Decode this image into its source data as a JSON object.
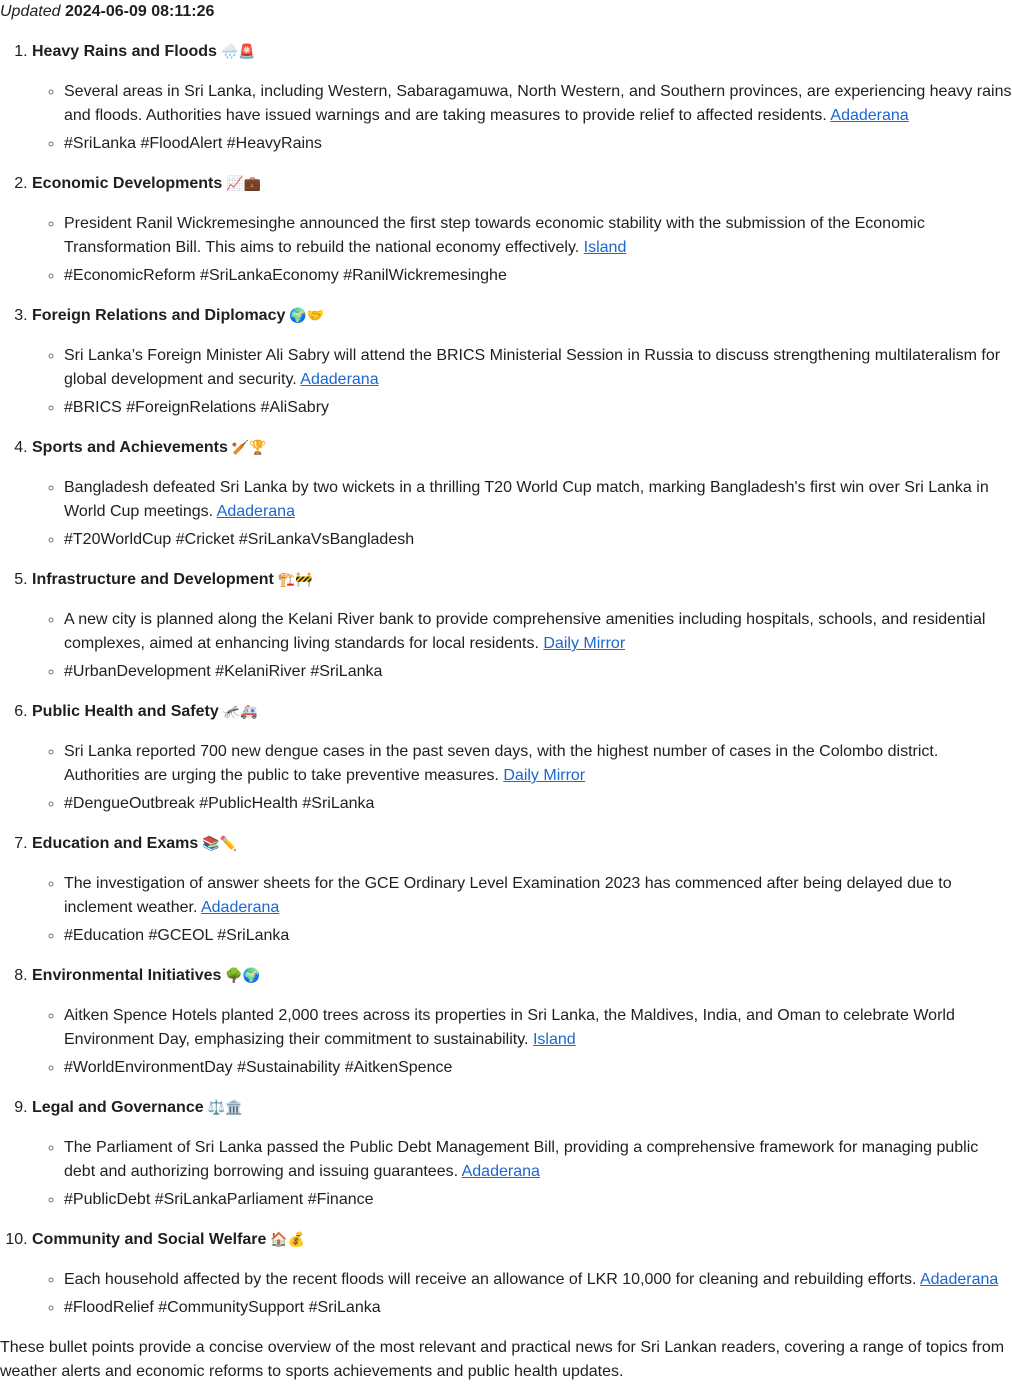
{
  "header": {
    "updated_label": "Updated",
    "updated_value": "2024-06-09 08:11:26"
  },
  "colors": {
    "text": "#1f1f1f",
    "link": "#1a66d2",
    "marker": "#777777"
  },
  "topics": [
    {
      "title": "Heavy Rains and Floods",
      "emoji": "🌧️🚨",
      "summary": "Several areas in Sri Lanka, including Western, Sabaragamuwa, North Western, and Southern provinces, are experiencing heavy rains and floods. Authorities have issued warnings and are taking measures to provide relief to affected residents.",
      "source": "Adaderana",
      "hashtags": "#SriLanka #FloodAlert #HeavyRains"
    },
    {
      "title": "Economic Developments",
      "emoji": "📈💼",
      "summary": "President Ranil Wickremesinghe announced the first step towards economic stability with the submission of the Economic Transformation Bill. This aims to rebuild the national economy effectively.",
      "source": "Island",
      "hashtags": "#EconomicReform #SriLankaEconomy #RanilWickremesinghe"
    },
    {
      "title": "Foreign Relations and Diplomacy",
      "emoji": "🌍🤝",
      "summary": "Sri Lanka’s Foreign Minister Ali Sabry will attend the BRICS Ministerial Session in Russia to discuss strengthening multilateralism for global development and security.",
      "source": "Adaderana",
      "hashtags": "#BRICS #ForeignRelations #AliSabry"
    },
    {
      "title": "Sports and Achievements",
      "emoji": "🏏🏆",
      "summary": "Bangladesh defeated Sri Lanka by two wickets in a thrilling T20 World Cup match, marking Bangladesh's first win over Sri Lanka in World Cup meetings.",
      "source": "Adaderana",
      "hashtags": "#T20WorldCup #Cricket #SriLankaVsBangladesh"
    },
    {
      "title": "Infrastructure and Development",
      "emoji": "🏗️🚧",
      "summary": "A new city is planned along the Kelani River bank to provide comprehensive amenities including hospitals, schools, and residential complexes, aimed at enhancing living standards for local residents.",
      "source": "Daily Mirror",
      "hashtags": "#UrbanDevelopment #KelaniRiver #SriLanka"
    },
    {
      "title": "Public Health and Safety",
      "emoji": "🦟🚑",
      "summary": "Sri Lanka reported 700 new dengue cases in the past seven days, with the highest number of cases in the Colombo district. Authorities are urging the public to take preventive measures.",
      "source": "Daily Mirror",
      "hashtags": "#DengueOutbreak #PublicHealth #SriLanka"
    },
    {
      "title": "Education and Exams",
      "emoji": "📚✏️",
      "summary": "The investigation of answer sheets for the GCE Ordinary Level Examination 2023 has commenced after being delayed due to inclement weather.",
      "source": "Adaderana",
      "hashtags": "#Education #GCEOL #SriLanka"
    },
    {
      "title": "Environmental Initiatives",
      "emoji": "🌳🌍",
      "summary": "Aitken Spence Hotels planted 2,000 trees across its properties in Sri Lanka, the Maldives, India, and Oman to celebrate World Environment Day, emphasizing their commitment to sustainability.",
      "source": "Island",
      "hashtags": "#WorldEnvironmentDay #Sustainability #AitkenSpence"
    },
    {
      "title": "Legal and Governance",
      "emoji": "⚖️🏛️",
      "summary": "The Parliament of Sri Lanka passed the Public Debt Management Bill, providing a comprehensive framework for managing public debt and authorizing borrowing and issuing guarantees.",
      "source": "Adaderana",
      "hashtags": "#PublicDebt #SriLankaParliament #Finance"
    },
    {
      "title": "Community and Social Welfare",
      "emoji": "🏠💰",
      "summary": "Each household affected by the recent floods will receive an allowance of LKR 10,000 for cleaning and rebuilding efforts.",
      "source": "Adaderana",
      "hashtags": "#FloodRelief #CommunitySupport #SriLanka"
    }
  ],
  "closing": "These bullet points provide a concise overview of the most relevant and practical news for Sri Lankan readers, covering a range of topics from weather alerts and economic reforms to sports achievements and public health updates."
}
